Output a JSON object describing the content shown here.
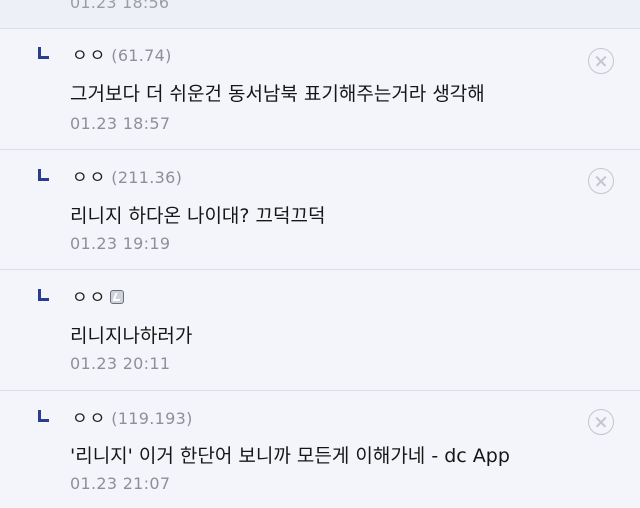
{
  "previous_reply": {
    "date": "01.23 18:56"
  },
  "replies": [
    {
      "nickname": "ㅇㅇ",
      "ip": "(61.74)",
      "content": "그거보다 더 쉬운건 동서남북 표기해주는거라 생각해",
      "date": "01.23 18:57",
      "has_delete": true,
      "delete_icon": "close-circle-icon"
    },
    {
      "nickname": "ㅇㅇ",
      "ip": "(211.36)",
      "content": "리니지 하다온 나이대? 끄덕끄덕",
      "date": "01.23 19:19",
      "has_delete": true,
      "delete_icon": "close-circle-icon"
    },
    {
      "nickname": "ㅇㅇ",
      "ip": "",
      "badge_icon": "fixed-nick-badge-icon",
      "content": "리니지나하러가",
      "date": "01.23 20:11",
      "has_delete": false
    },
    {
      "nickname": "ㅇㅇ",
      "ip": "(119.193)",
      "content": "'리니지' 이거 한단어 보니까 모든게 이해가네 - dc App",
      "date": "01.23 21:07",
      "has_delete": true,
      "delete_icon": "close-circle-icon"
    }
  ],
  "colors": {
    "reply_arrow": "#2a3d8f",
    "background": "#f4f5fa",
    "meta_text": "#8e9099",
    "divider": "#dcdee6"
  }
}
